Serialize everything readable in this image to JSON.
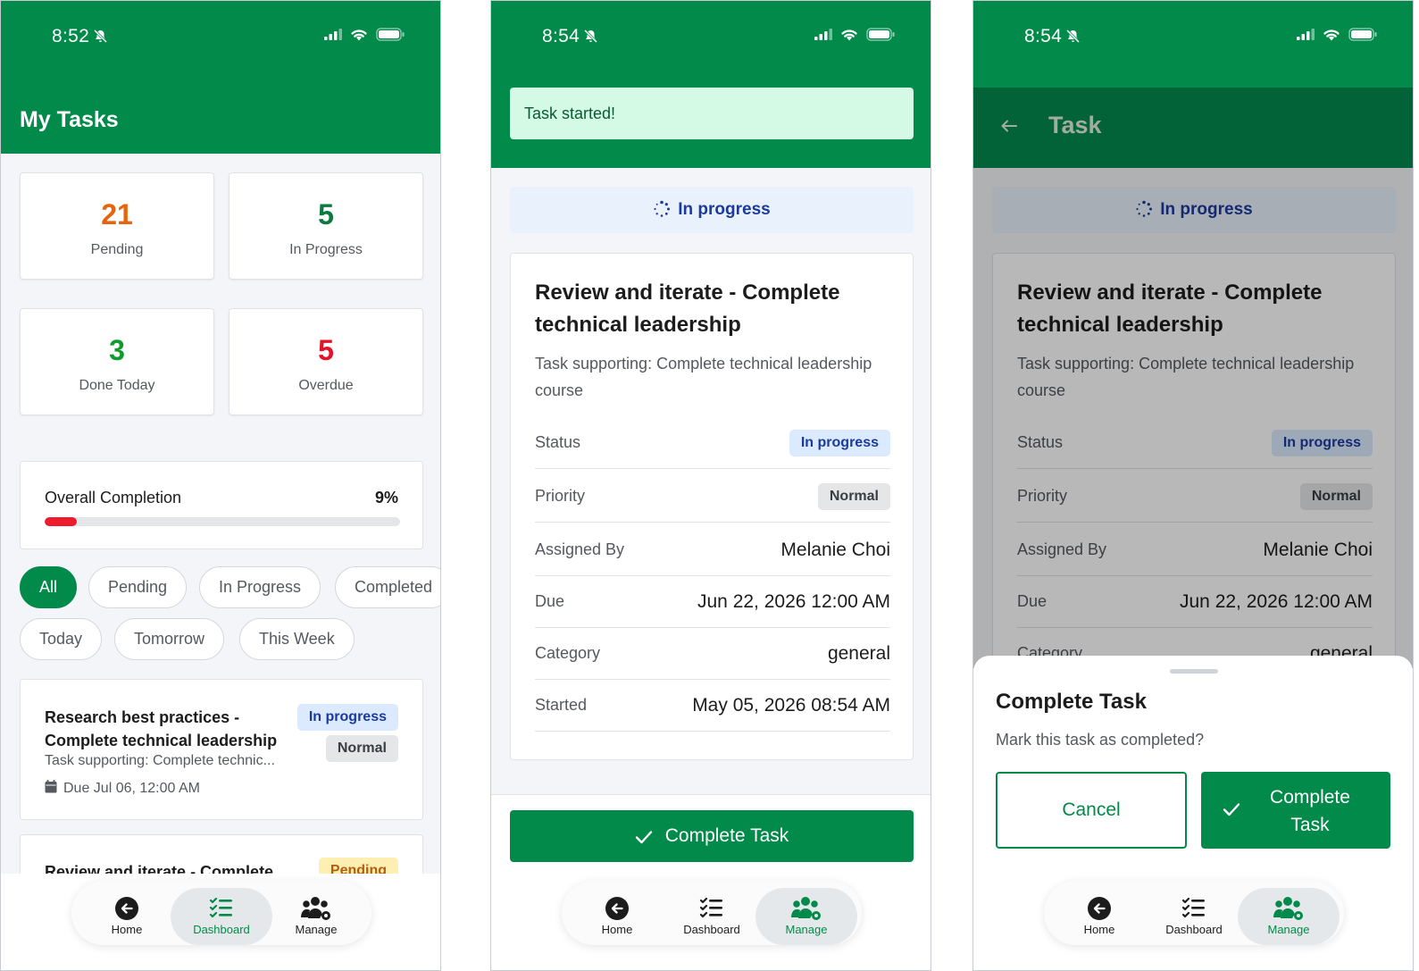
{
  "status_bar": [
    {
      "time": "8:52"
    },
    {
      "time": "8:54"
    },
    {
      "time": "8:54"
    }
  ],
  "screen1": {
    "title": "My Tasks",
    "stats": [
      {
        "value": "21",
        "label": "Pending",
        "color": "#e8640c"
      },
      {
        "value": "5",
        "label": "In Progress",
        "color": "#0a7a3e"
      },
      {
        "value": "3",
        "label": "Done Today",
        "color": "#0d9c2d"
      },
      {
        "value": "5",
        "label": "Overdue",
        "color": "#e5102a"
      }
    ],
    "completion": {
      "label": "Overall Completion",
      "percent_text": "9%",
      "progress": 0.09
    },
    "filters_row1": [
      "All",
      "Pending",
      "In Progress",
      "Completed"
    ],
    "filters_row2": [
      "Today",
      "Tomorrow",
      "This Week"
    ],
    "active_filter": "All",
    "tasks": [
      {
        "title": "Research best practices - Complete technical leadership",
        "subtitle": "Task supporting: Complete technic...",
        "due": "Due Jul 06, 12:00 AM",
        "status": "In progress",
        "priority": "Normal"
      },
      {
        "title": "Review and iterate - Complete",
        "status": "Pending"
      }
    ]
  },
  "task_detail": {
    "toast": "Task started!",
    "status_banner": "In progress",
    "title": "Review and iterate - Complete technical leadership",
    "subtitle": "Task supporting: Complete technical leadership course",
    "fields": {
      "status_label": "Status",
      "status_value": "In progress",
      "priority_label": "Priority",
      "priority_value": "Normal",
      "assigned_label": "Assigned By",
      "assigned_value": "Melanie Choi",
      "due_label": "Due",
      "due_value": "Jun 22, 2026 12:00 AM",
      "category_label": "Category",
      "category_value": "general",
      "started_label": "Started",
      "started_value": "May 05, 2026 08:54 AM"
    },
    "complete_button": "Complete Task"
  },
  "screen3": {
    "header_title": "Task",
    "sheet": {
      "title": "Complete Task",
      "message": "Mark this task as completed?",
      "cancel": "Cancel",
      "confirm": "Complete Task"
    }
  },
  "nav": {
    "home": "Home",
    "dashboard": "Dashboard",
    "manage": "Manage"
  },
  "colors": {
    "brand": "#028a4a",
    "brand_dark": "#026238",
    "toast_bg": "#d4fae5",
    "info_bg": "#e9f1fc"
  },
  "icons": [
    "bell-slash-icon",
    "signal-icon",
    "wifi-icon",
    "battery-icon",
    "calendar-icon",
    "spinner-icon",
    "check-icon",
    "back-arrow-icon",
    "home-icon",
    "dashboard-icon",
    "manage-icon"
  ]
}
